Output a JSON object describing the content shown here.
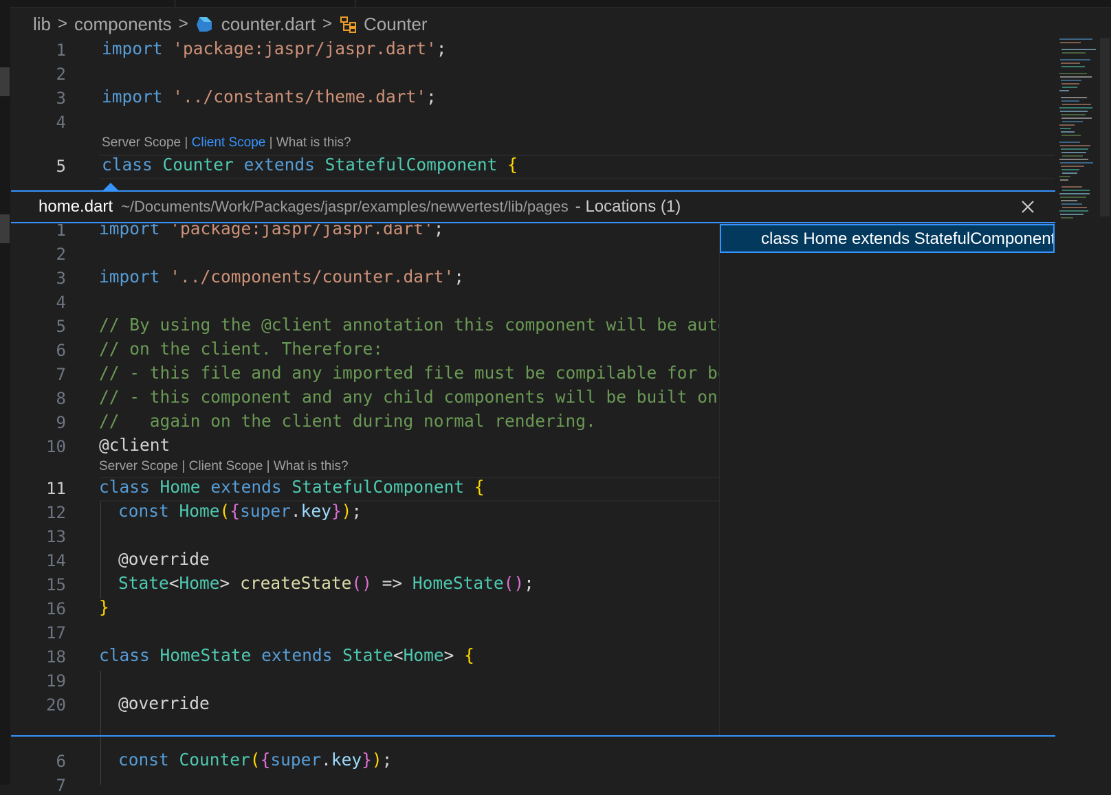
{
  "breadcrumb": {
    "items": [
      "lib",
      "components",
      "counter.dart",
      "Counter"
    ],
    "separator": ">"
  },
  "top_editor": {
    "line_numbers": [
      "1",
      "2",
      "3",
      "4",
      "5"
    ],
    "codelens": {
      "server": "Server Scope",
      "sep1": " | ",
      "client": "Client Scope",
      "sep2": " | ",
      "what": "What is this?"
    },
    "lines": {
      "l1": {
        "kw": "import",
        "str": "'package:jaspr/jaspr.dart'",
        "end": ";"
      },
      "l3": {
        "kw": "import",
        "str": "'../constants/theme.dart'",
        "end": ";"
      },
      "l5": {
        "kw1": "class",
        "cls1": "Counter",
        "kw2": "extends",
        "cls2": "StatefulComponent",
        "brace": "{"
      }
    }
  },
  "peek": {
    "file": "home.dart",
    "path": "~/Documents/Work/Packages/jaspr/examples/newvertest/lib/pages",
    "locations": "- Locations (1)",
    "reference": "class Home extends StatefulComponent {",
    "line_numbers": [
      "1",
      "2",
      "3",
      "4",
      "5",
      "6",
      "7",
      "8",
      "9",
      "10",
      "11",
      "12",
      "13",
      "14",
      "15",
      "16",
      "17",
      "18",
      "19",
      "20"
    ],
    "codelens": {
      "server": "Server Scope",
      "sep1": " | ",
      "client": "Client Scope",
      "sep2": " | ",
      "what": "What is this?"
    },
    "lines": {
      "l1": {
        "kw": "import",
        "str": "'package:jaspr/jaspr.dart'",
        "end": ";"
      },
      "l3": {
        "kw": "import",
        "str": "'../components/counter.dart'",
        "end": ";"
      },
      "l5": "// By using the @client annotation this component will be automatically compiled to javascript and mounted",
      "l6": "// on the client. Therefore:",
      "l7": "// - this file and any imported file must be compilable for both server and client environments.",
      "l8": "// - this component and any child components will be built once on the server during pre-rendering and then",
      "l9": "//   again on the client during normal rendering.",
      "l10": "@client",
      "l11": {
        "kw1": "class",
        "cls1": "Home",
        "kw2": "extends",
        "cls2": "StatefulComponent",
        "brace": "{"
      },
      "l12": {
        "kw": "const",
        "cls": "Home",
        "p1": "(",
        "b1": "{",
        "sup": "super",
        "dot": ".",
        "key": "key",
        "b2": "}",
        "p2": ")",
        "end": ";"
      },
      "l14": "@override",
      "l15": {
        "cls1": "State",
        "lt": "<",
        "cls2": "Home",
        "gt": ">",
        "fn": "createState",
        "p": "()",
        "arrow": " => ",
        "cls3": "HomeState",
        "p2": "()",
        "end": ";"
      },
      "l16": "}",
      "l18": {
        "kw1": "class",
        "cls1": "HomeState",
        "kw2": "extends",
        "cls2": "State",
        "lt": "<",
        "cls3": "Home",
        "gt": ">",
        "brace": "{"
      },
      "l20": "@override"
    }
  },
  "bottom_editor": {
    "line_numbers": [
      "6",
      "7"
    ],
    "l6": {
      "kw": "const",
      "cls": "Counter",
      "p1": "(",
      "b1": "{",
      "sup": "super",
      "dot": ".",
      "key": "key",
      "b2": "}",
      "p2": ")",
      "end": ";"
    }
  },
  "colors": {
    "background": "#1f1f1f",
    "accent": "#3794ff",
    "keyword": "#569cd6",
    "string": "#ce9178",
    "type": "#4ec9b0",
    "comment": "#6a9955"
  }
}
